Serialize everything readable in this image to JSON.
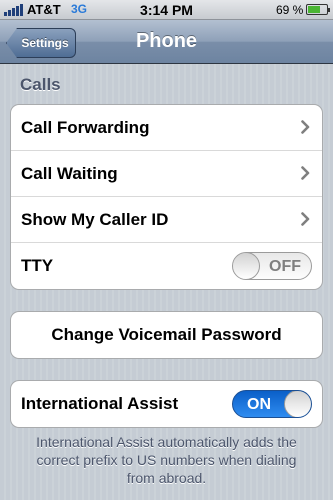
{
  "status_bar": {
    "carrier": "AT&T",
    "network": "3G",
    "time": "3:14 PM",
    "battery_percent": "69 %",
    "battery_level": 0.69
  },
  "nav": {
    "back_label": "Settings",
    "title": "Phone"
  },
  "calls_section": {
    "header": "Calls",
    "rows": [
      {
        "label": "Call Forwarding",
        "accessory": "chevron"
      },
      {
        "label": "Call Waiting",
        "accessory": "chevron"
      },
      {
        "label": "Show My Caller ID",
        "accessory": "chevron"
      },
      {
        "label": "TTY",
        "accessory": "switch",
        "switch_text": "OFF",
        "on": false
      }
    ]
  },
  "voicemail": {
    "button_label": "Change Voicemail Password"
  },
  "international": {
    "label": "International Assist",
    "switch_text": "ON",
    "on": true,
    "note": "International Assist automatically adds the correct prefix to US numbers when dialing from abroad."
  },
  "colors": {
    "nav_bar": "#6d84a1",
    "switch_on": "#2f8cf0",
    "background": "#c5ccd4"
  }
}
